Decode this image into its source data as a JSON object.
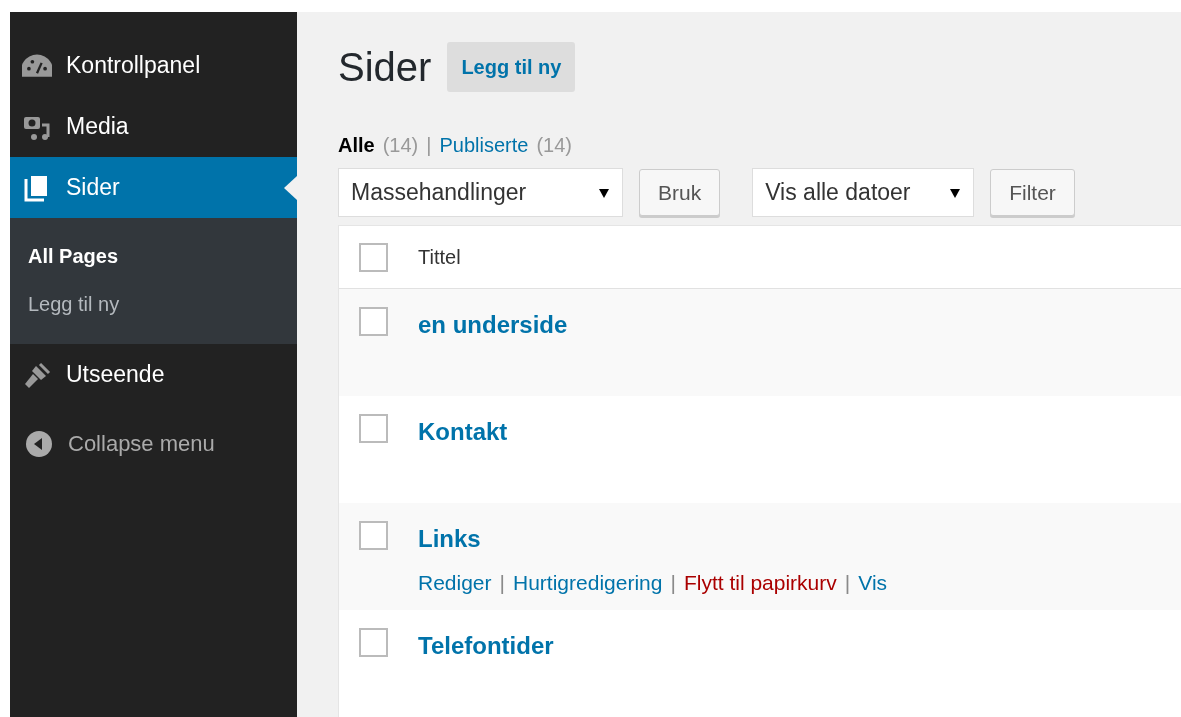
{
  "sidebar": {
    "items": [
      {
        "label": "Kontrollpanel",
        "kind": "dashboard",
        "selected": false
      },
      {
        "label": "Media",
        "kind": "media",
        "selected": false
      },
      {
        "label": "Sider",
        "kind": "pages",
        "selected": true,
        "submenu": [
          {
            "label": "All Pages",
            "selected": true
          },
          {
            "label": "Legg til ny",
            "selected": false
          }
        ]
      },
      {
        "label": "Utseende",
        "kind": "brush",
        "selected": false
      }
    ],
    "collapse": "Collapse menu"
  },
  "page": {
    "title": "Sider",
    "add_new": "Legg til ny"
  },
  "views": [
    {
      "label": "Alle",
      "count": "(14)",
      "selected": true
    },
    {
      "label": "Publiserte",
      "count": "(14)",
      "selected": false
    }
  ],
  "view_separator": "|",
  "filters": {
    "bulk_action": "Massehandlinger",
    "apply": "Bruk",
    "dates": "Vis alle datoer",
    "filter": "Filter"
  },
  "table": {
    "columns": [
      "Tittel"
    ],
    "header_checked": false,
    "rows": [
      {
        "title": "en underside",
        "checked": false
      },
      {
        "title": "Kontakt",
        "checked": false
      },
      {
        "title": "Links",
        "checked": false,
        "actions": [
          {
            "label": "Rediger",
            "kind": "link"
          },
          {
            "label": "Hurtigredigering",
            "kind": "link"
          },
          {
            "label": "Flytt til papirkurv",
            "kind": "delete"
          },
          {
            "label": "Vis",
            "kind": "link"
          }
        ]
      },
      {
        "title": "Telefontider",
        "checked": false
      }
    ],
    "action_separator": "|"
  }
}
